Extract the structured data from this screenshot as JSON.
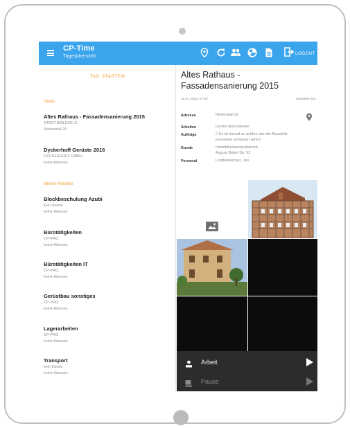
{
  "app": {
    "title": "CP-Time",
    "subtitle": "Tagesübersicht",
    "logout_label": "LOGOUT"
  },
  "toolbar_icons": [
    "location-icon",
    "refresh-icon",
    "people-icon",
    "chart-icon",
    "document-icon",
    "logout-icon"
  ],
  "left": {
    "start_day": "TAG STARTEN",
    "section_today": "Heute",
    "section_internal": "Interne Arbeiten",
    "today_items": [
      {
        "title": "Altes Rathaus - Fassadensanierung 2015",
        "line1": "STADT BIELEFELD",
        "line2": "Niederwall 25"
      },
      {
        "title": "Dyckerhoff Gerüste 2016",
        "line1": "DYCKERHOFF GMBH",
        "line2": "keine Adresse"
      }
    ],
    "internal_items": [
      {
        "title": "Blockbeschulung Azubi",
        "line1": "kein Kunde",
        "line2": "keine Adresse"
      },
      {
        "title": "Bürotätigkeiten",
        "line1": "CP-PRO",
        "line2": "keine Adresse"
      },
      {
        "title": "Bürotätigkeiten IT",
        "line1": "CP-PRO",
        "line2": "keine Adresse"
      },
      {
        "title": "Gerüstbau sonstiges",
        "line1": "CP-PRO",
        "line2": "keine Adresse"
      },
      {
        "title": "Lagerarbeiten",
        "line1": "CP-PRO",
        "line2": "keine Adresse"
      },
      {
        "title": "Transport",
        "line1": "kein Kunde",
        "line2": "keine Adresse"
      }
    ]
  },
  "detail": {
    "title": "Altes Rathaus - Fassadensanierung 2015",
    "date": "22.01.2016, 07:00",
    "code": "1509909-049",
    "address_label": "Adresse",
    "address_value": "Niederwall 25",
    "work_label": "Arbeiten",
    "work_value": "Gerüst demontieren",
    "orders_label": "Aufträge",
    "orders_value": "// Es ist darauf zu achten das die Baustelle besenrein verlassen wird //",
    "customer_label": "Kunde",
    "customer_value_1": "Immobilienservicebetrieb",
    "customer_value_2": "August Bebel Str. 92",
    "staff_label": "Personal",
    "staff_value": "Loddenkemper, Jan"
  },
  "actions": {
    "work_label": "Arbeit",
    "pause_label": "Pause"
  },
  "colors": {
    "appbar": "#3aa4ec",
    "accent_orange": "#f39a2f",
    "bottom_bar": "#2c2c2c"
  }
}
